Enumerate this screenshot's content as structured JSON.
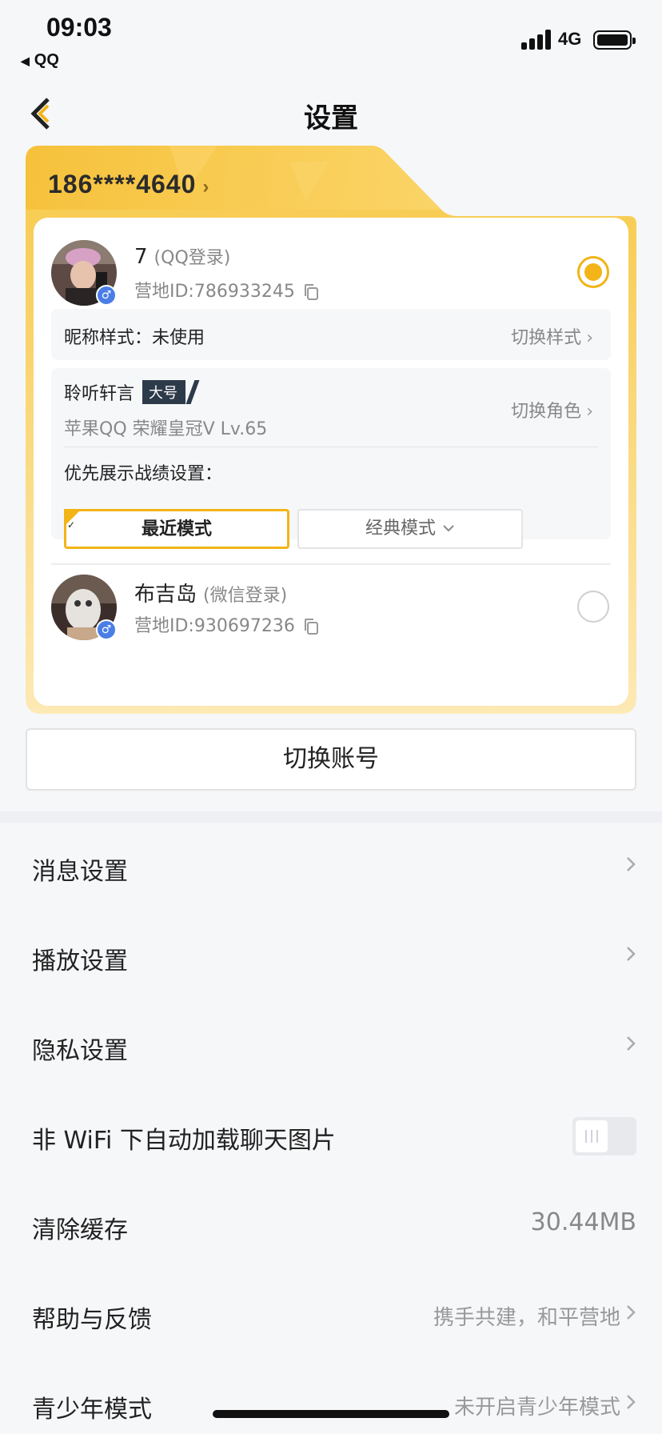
{
  "status_bar": {
    "time": "09:03",
    "back_app": "QQ",
    "network": "4G"
  },
  "nav": {
    "title": "设置"
  },
  "account_card": {
    "phone": "186****4640",
    "accounts": [
      {
        "name": "7",
        "login": "(QQ登录)",
        "camp_id": "营地ID:786933245",
        "selected": true
      },
      {
        "name": "布吉岛",
        "login": "(微信登录)",
        "camp_id": "营地ID:930697236",
        "selected": false
      }
    ],
    "nickname_style": {
      "label": "昵称样式：",
      "value": "未使用",
      "action": "切换样式"
    },
    "role": {
      "name": "聆听轩言",
      "tag": "大号",
      "detail": "苹果QQ  荣耀皇冠Ⅴ  Lv.65",
      "action": "切换角色"
    },
    "record_setting": {
      "label": "优先展示战绩设置：",
      "modes": [
        "最近模式",
        "经典模式"
      ],
      "selected_index": 0
    }
  },
  "switch_account_label": "切换账号",
  "menu": {
    "items": [
      {
        "label": "消息设置"
      },
      {
        "label": "播放设置"
      },
      {
        "label": "隐私设置"
      },
      {
        "label": "非 WiFi 下自动加载聊天图片",
        "toggle": false
      },
      {
        "label": "清除缓存",
        "value": "30.44MB"
      },
      {
        "label": "帮助与反馈",
        "value": "携手共建，和平营地"
      },
      {
        "label": "青少年模式",
        "value": "未开启青少年模式"
      }
    ]
  },
  "colors": {
    "accent": "#f2b417",
    "card_gold": "#f7c948",
    "sex_badge": "#4a7ee6"
  }
}
